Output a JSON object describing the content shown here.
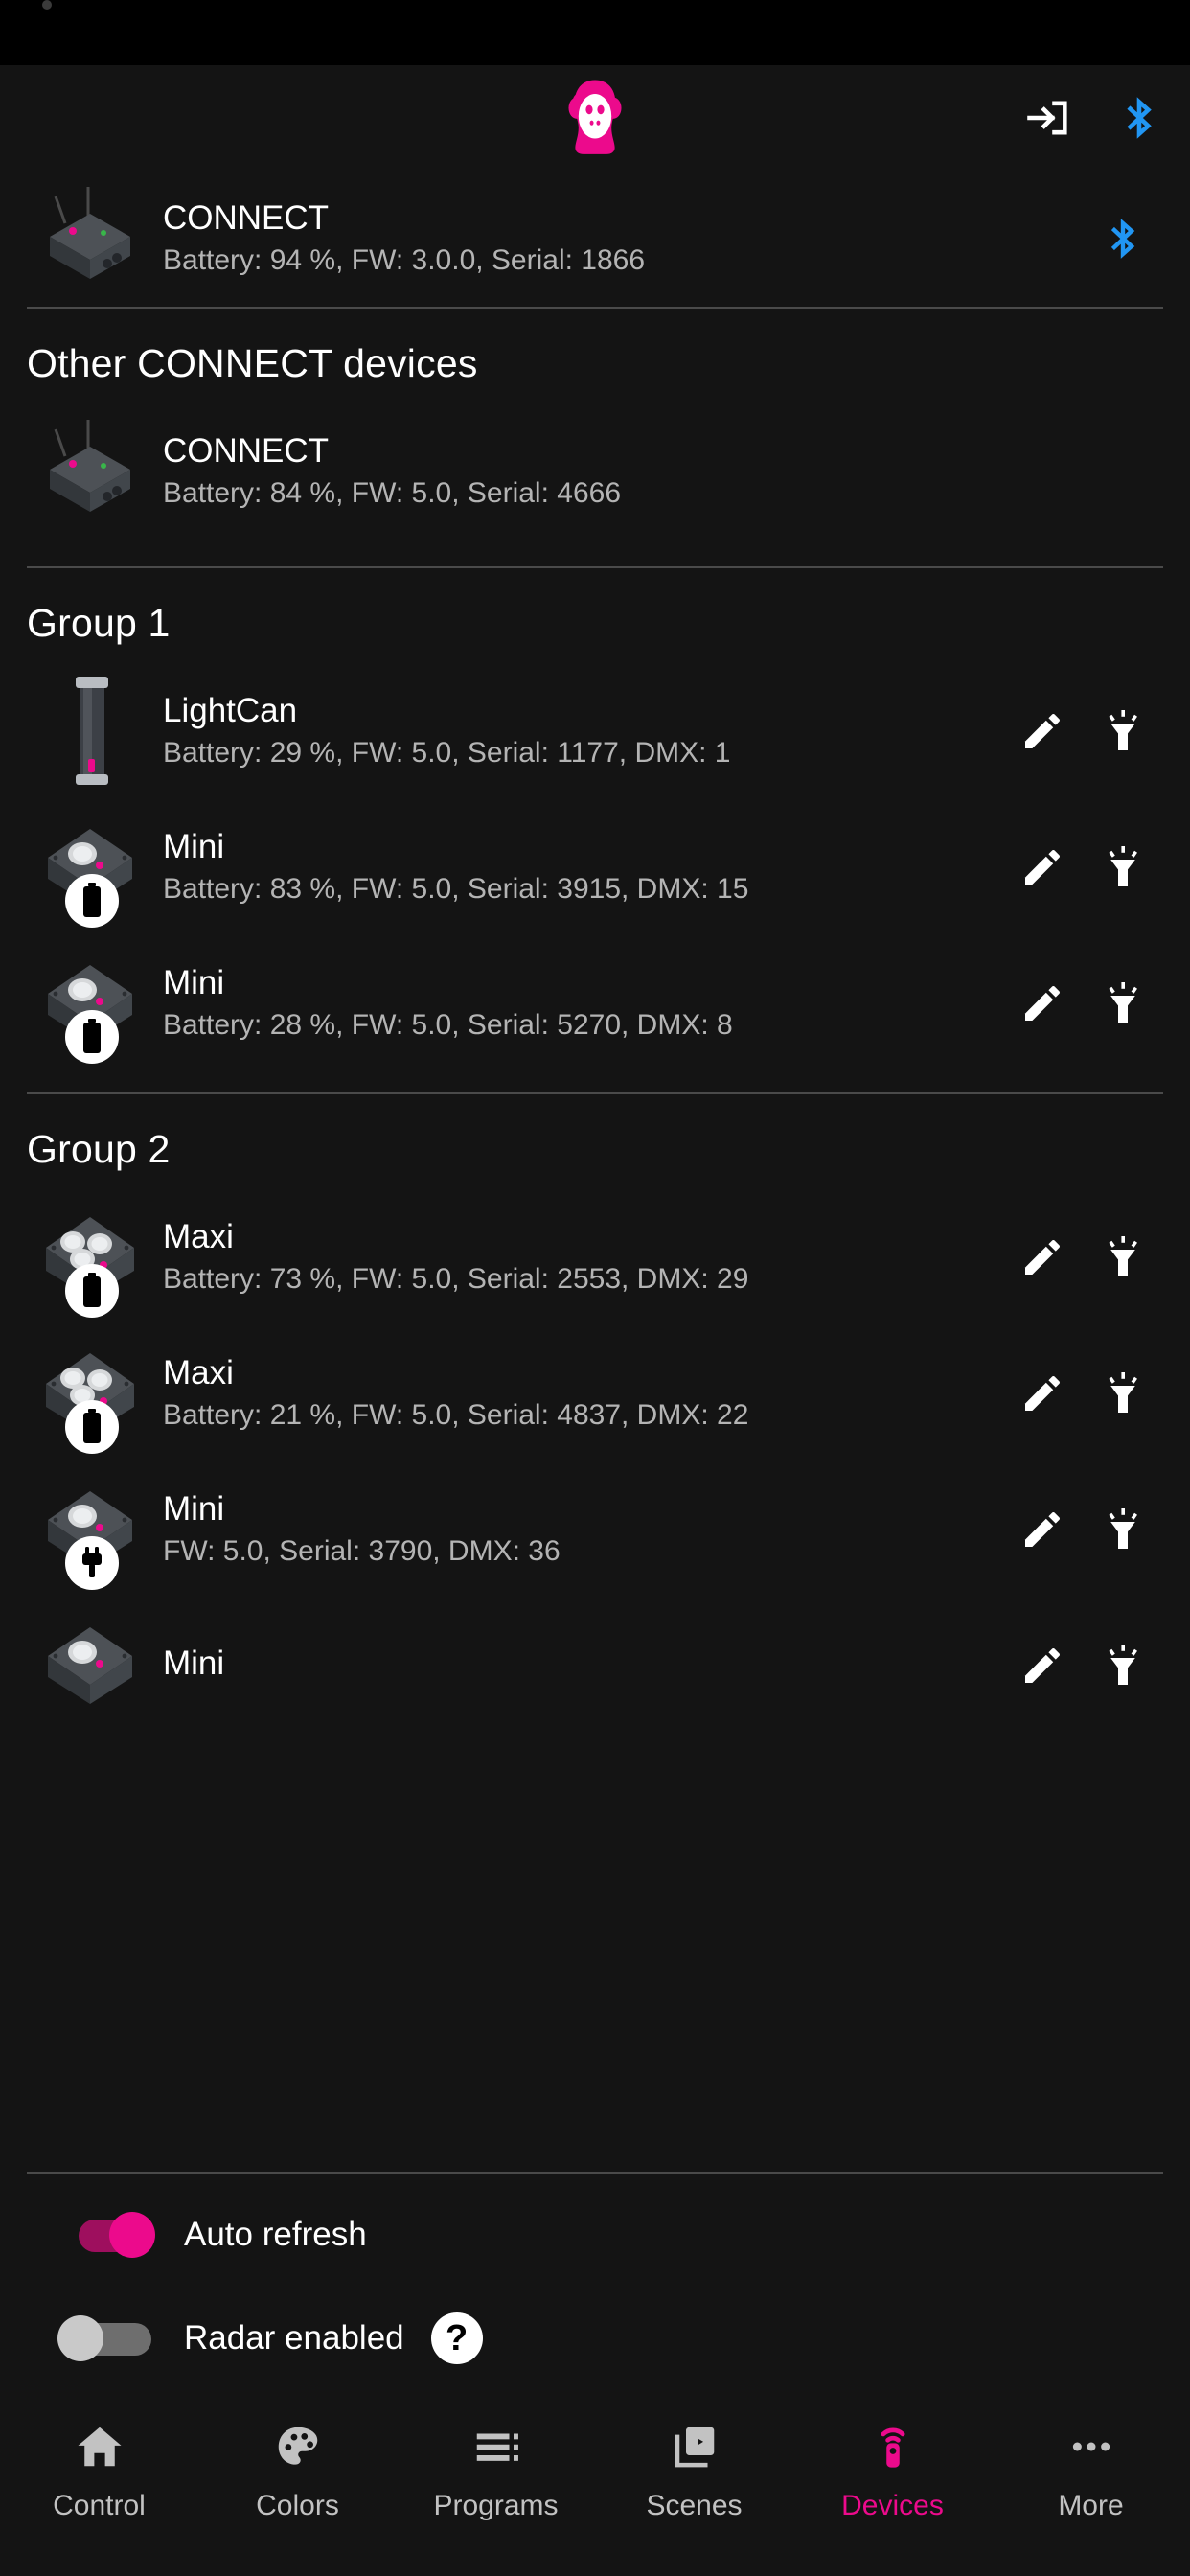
{
  "app": {
    "logo_icon": "monkey-logo",
    "accent_color": "#ec0a8c",
    "bluetooth_color": "#2196f3",
    "background_color": "#141414"
  },
  "app_bar": {
    "login_icon": "login-arrow-icon",
    "bluetooth_icon": "bluetooth-icon"
  },
  "connected": {
    "device": {
      "name": "CONNECT",
      "meta": "Battery: 94 %,  FW: 3.0.0,  Serial: 1866",
      "thumb_icon": "connect-box-icon",
      "bluetooth_icon": "bluetooth-icon"
    }
  },
  "other_connect": {
    "title": "Other CONNECT devices",
    "devices": [
      {
        "name": "CONNECT",
        "meta": "Battery: 84 %,  FW: 5.0,  Serial: 4666",
        "thumb_icon": "connect-box-icon"
      }
    ]
  },
  "groups": [
    {
      "title": "Group 1",
      "devices": [
        {
          "name": "LightCan",
          "meta": "Battery: 29 %,  FW: 5.0,  Serial: 1177, DMX: 1",
          "thumb_icon": "lightcan-tube-icon",
          "badge_icon": "",
          "edit_icon": "pencil-icon",
          "identify_icon": "flashlight-icon"
        },
        {
          "name": "Mini",
          "meta": "Battery: 83 %,  FW: 5.0, Serial: 3915,  DMX: 15",
          "thumb_icon": "mini-light-icon",
          "badge_icon": "battery-icon",
          "edit_icon": "pencil-icon",
          "identify_icon": "flashlight-icon"
        },
        {
          "name": "Mini",
          "meta": "Battery: 28 %,  FW: 5.0, Serial: 5270,  DMX: 8",
          "thumb_icon": "mini-light-icon",
          "badge_icon": "battery-icon",
          "edit_icon": "pencil-icon",
          "identify_icon": "flashlight-icon"
        }
      ]
    },
    {
      "title": "Group 2",
      "devices": [
        {
          "name": "Maxi",
          "meta": "Battery: 73 %,  FW: 5.0, Serial: 2553,  DMX: 29",
          "thumb_icon": "maxi-light-icon",
          "badge_icon": "battery-icon",
          "edit_icon": "pencil-icon",
          "identify_icon": "flashlight-icon"
        },
        {
          "name": "Maxi",
          "meta": "Battery: 21 %,  FW: 5.0,  Serial: 4837, DMX: 22",
          "thumb_icon": "maxi-light-icon",
          "badge_icon": "battery-icon",
          "edit_icon": "pencil-icon",
          "identify_icon": "flashlight-icon"
        },
        {
          "name": "Mini",
          "meta": "FW: 5.0,  Serial: 3790,  DMX: 36",
          "thumb_icon": "mini-light-icon",
          "badge_icon": "power-plug-icon",
          "edit_icon": "pencil-icon",
          "identify_icon": "flashlight-icon"
        },
        {
          "name": "Mini",
          "meta": "",
          "thumb_icon": "mini-light-icon",
          "badge_icon": "",
          "edit_icon": "pencil-icon",
          "identify_icon": "flashlight-icon"
        }
      ]
    }
  ],
  "settings": {
    "auto_refresh": {
      "label": "Auto refresh",
      "state": "on"
    },
    "radar_enabled": {
      "label": "Radar enabled",
      "state": "off",
      "help_label": "?"
    }
  },
  "bottom_nav": {
    "active": "Devices",
    "items": [
      {
        "label": "Control",
        "icon": "home-icon"
      },
      {
        "label": "Colors",
        "icon": "palette-icon"
      },
      {
        "label": "Programs",
        "icon": "list-icon"
      },
      {
        "label": "Scenes",
        "icon": "scenes-play-icon"
      },
      {
        "label": "Devices",
        "icon": "remote-signal-icon"
      },
      {
        "label": "More",
        "icon": "ellipsis-icon"
      }
    ]
  }
}
